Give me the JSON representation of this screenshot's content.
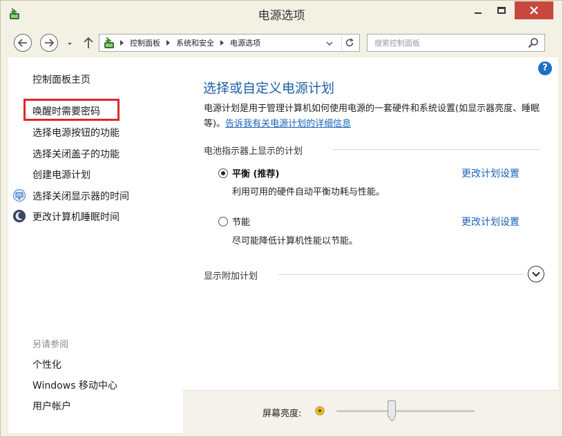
{
  "window": {
    "title": "电源选项"
  },
  "address": {
    "breadcrumbs": [
      "控制面板",
      "系统和安全",
      "电源选项"
    ]
  },
  "search": {
    "placeholder": "搜索控制面板"
  },
  "sidebar": {
    "home": "控制面板主页",
    "items": [
      {
        "label": "唤醒时需要密码",
        "highlighted": true
      },
      {
        "label": "选择电源按钮的功能"
      },
      {
        "label": "选择关闭盖子的功能"
      },
      {
        "label": "创建电源计划"
      },
      {
        "label": "选择关闭显示器的时间",
        "icon": "monitor-icon"
      },
      {
        "label": "更改计算机睡眠时间",
        "icon": "moon-icon"
      }
    ],
    "see_also_header": "另请参阅",
    "see_also": [
      {
        "label": "个性化"
      },
      {
        "label": "Windows 移动中心"
      },
      {
        "label": "用户帐户"
      }
    ]
  },
  "main": {
    "title": "选择或自定义电源计划",
    "description": "电源计划是用于管理计算机如何使用电源的一套硬件和系统设置(如显示器亮度、睡眠等)。",
    "description_link": "告诉我有关电源计划的详细信息",
    "battery_section": "电池指示器上显示的计划",
    "plans": [
      {
        "name": "平衡 (推荐)",
        "description": "利用可用的硬件自动平衡功耗与性能。",
        "link": "更改计划设置",
        "selected": true
      },
      {
        "name": "节能",
        "description": "尽可能降低计算机性能以节能。",
        "link": "更改计划设置",
        "selected": false
      }
    ],
    "additional_section": "显示附加计划"
  },
  "bottom": {
    "brightness_label": "屏幕亮度:",
    "brightness_level": 0.4
  },
  "colors": {
    "accent": "#1e5fa8",
    "link": "#1862b8",
    "highlight_border": "#e0262a",
    "close_button": "#c7493e"
  }
}
